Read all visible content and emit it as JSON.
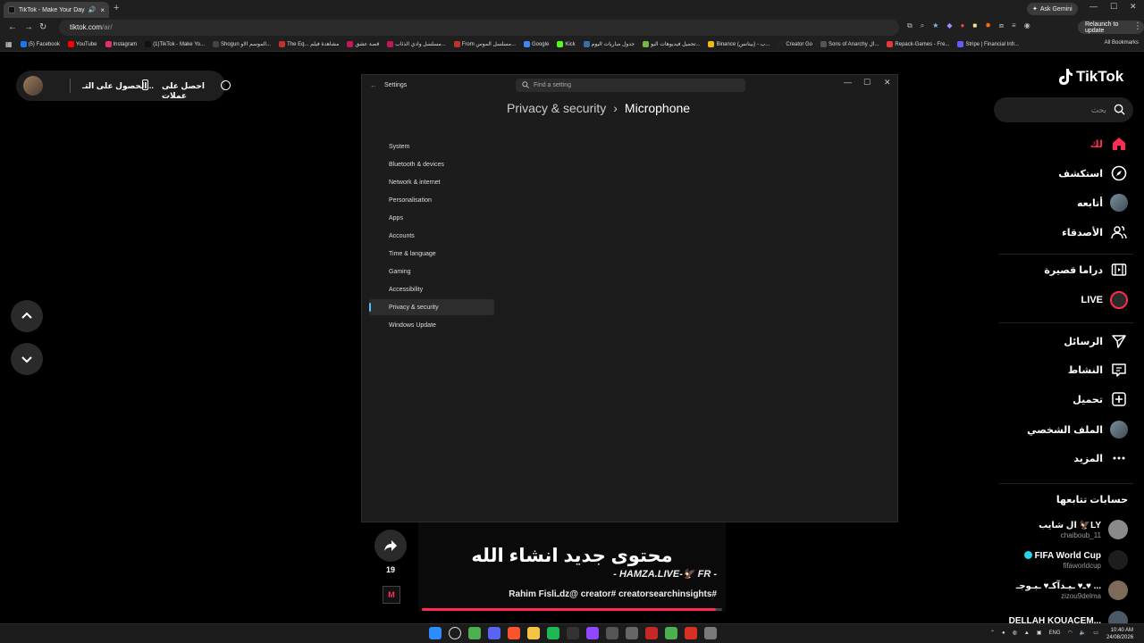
{
  "browser": {
    "tab": {
      "title": "TikTok - Make Your Day",
      "close": "×"
    },
    "new_tab": "+",
    "ask_gemini": "Ask Gemini",
    "window_controls": {
      "minimize": "—",
      "maximize": "☐",
      "close": "✕"
    },
    "url": {
      "host": "tiktok.com",
      "path": "/ar/"
    },
    "relaunch": "Relaunch to update",
    "bookmarks": [
      {
        "label": "(5) Facebook",
        "color": "#1877f2"
      },
      {
        "label": "YouTube",
        "color": "#ff0000"
      },
      {
        "label": "Instagram",
        "color": "#e1306c"
      },
      {
        "label": "(1)TikTok - Make Yo...",
        "color": "#111111"
      },
      {
        "label": "Shogun الموسم الاو...",
        "color": "#444444"
      },
      {
        "label": "The Eq... مشاهدة فيلم",
        "color": "#c4302b"
      },
      {
        "label": "قصة عشق",
        "color": "#c2185b"
      },
      {
        "label": "مسلسل وادي الذئاب...",
        "color": "#c2185b"
      },
      {
        "label": "From مسلسل الموس...",
        "color": "#c4302b"
      },
      {
        "label": "Google",
        "color": "#4285f4"
      },
      {
        "label": "Kick",
        "color": "#53fc18"
      },
      {
        "label": "جدول مباريات اليوم",
        "color": "#3a6ea5"
      },
      {
        "label": "تحميل فيديوهات اليو...",
        "color": "#7cb342"
      },
      {
        "label": "Binance (بينانس) - ب...",
        "color": "#f0b90b"
      },
      {
        "label": "Creator Go",
        "color": "#222222"
      },
      {
        "label": "Sons of Anarchy ال...",
        "color": "#555555"
      },
      {
        "label": "Repack-Games - Fre...",
        "color": "#e53935"
      },
      {
        "label": "Stripe | Financial Infr...",
        "color": "#635bff"
      }
    ],
    "all_bookmarks": "All Bookmarks"
  },
  "tiktok": {
    "profile_pill": {
      "action1": "الحصول على التـ...",
      "action2": "احصل على عملات"
    },
    "logo": "TikTok",
    "search_placeholder": "بحث",
    "nav": [
      {
        "label": "لك",
        "icon": "home-icon",
        "active": true
      },
      {
        "label": "استكشف",
        "icon": "compass-icon",
        "active": false
      },
      {
        "label": "أتابعه",
        "icon": "following-avatar-icon",
        "active": false
      },
      {
        "label": "الأصدقاء",
        "icon": "friends-icon",
        "active": false
      },
      {
        "label": "دراما قصيرة",
        "icon": "drama-icon",
        "active": false
      },
      {
        "label": "LIVE",
        "icon": "live-icon",
        "active": false
      },
      {
        "label": "الرسائل",
        "icon": "send-icon",
        "active": false
      },
      {
        "label": "النشاط",
        "icon": "activity-icon",
        "active": false
      },
      {
        "label": "تحميل",
        "icon": "upload-icon",
        "active": false
      },
      {
        "label": "الملف الشخصي",
        "icon": "profile-avatar-icon",
        "active": false
      },
      {
        "label": "المزيد",
        "icon": "more-icon",
        "active": false
      }
    ],
    "following_title": "حسابات تتابعها",
    "following": [
      {
        "name": "ال شايب 🦅LY",
        "handle": "chaiboub_11",
        "verified": false,
        "avatar_color": "#8a8a8a"
      },
      {
        "name": "FIFA World Cup",
        "handle": "fifaworldcup",
        "verified": true,
        "avatar_color": "#1d1d1d"
      },
      {
        "name": "ـ♥ ـيـدآكـ♥ ـبـوجـ♥ ...",
        "handle": "zizou9delma",
        "verified": false,
        "avatar_color": "#7d6a58"
      },
      {
        "name": "DELLAH KOUACEM...",
        "handle": "",
        "verified": false,
        "avatar_color": "#4b5966"
      }
    ],
    "video": {
      "title": "محتوى جديد انشاء الله",
      "subtitle": "- HAMZA.LIVE-🦅 FR -",
      "caption": "Rahim Fisliـdz@ creator# creatorsearchinsights#",
      "progress": 0.98
    },
    "share_count": "19",
    "sound_label": "M",
    "colors": {
      "accent": "#fe2c55",
      "bg": "#000000"
    }
  },
  "settings_window": {
    "title": "Settings",
    "search_placeholder": "Find a setting",
    "breadcrumb": {
      "parent": "Privacy & security",
      "separator": "›",
      "current": "Microphone"
    },
    "nav_items": [
      {
        "label": "System",
        "selected": false
      },
      {
        "label": "Bluetooth & devices",
        "selected": false
      },
      {
        "label": "Network & internet",
        "selected": false
      },
      {
        "label": "Personalisation",
        "selected": false
      },
      {
        "label": "Apps",
        "selected": false
      },
      {
        "label": "Accounts",
        "selected": false
      },
      {
        "label": "Time & language",
        "selected": false
      },
      {
        "label": "Gaming",
        "selected": false
      },
      {
        "label": "Accessibility",
        "selected": false
      },
      {
        "label": "Privacy & security",
        "selected": true
      },
      {
        "label": "Windows Update",
        "selected": false
      }
    ],
    "accent": "#4cc2ff"
  },
  "taskbar": {
    "apps": [
      {
        "icon": "windows-start-icon",
        "color": "#2d8cff"
      },
      {
        "icon": "search-icon",
        "color": "#444444"
      },
      {
        "icon": "chrome-icon",
        "color": "#4caf50"
      },
      {
        "icon": "discord-icon",
        "color": "#5865f2"
      },
      {
        "icon": "brave-icon",
        "color": "#fb542b"
      },
      {
        "icon": "file-explorer-icon",
        "color": "#f6c344"
      },
      {
        "icon": "spotify-icon",
        "color": "#1db954"
      },
      {
        "icon": "obs-icon",
        "color": "#333333"
      },
      {
        "icon": "twitch-icon",
        "color": "#9146ff"
      },
      {
        "icon": "app-icon",
        "color": "#555555"
      },
      {
        "icon": "xbox-icon",
        "color": "#666666"
      },
      {
        "icon": "record-icon",
        "color": "#c62828"
      },
      {
        "icon": "chrome-profile-icon",
        "color": "#4caf50"
      },
      {
        "icon": "gmail-icon",
        "color": "#d93025"
      },
      {
        "icon": "settings-icon",
        "color": "#7a7a7a"
      }
    ],
    "tray_lang": "ENG",
    "time": "10:40 AM",
    "date": "24/08/2026"
  }
}
